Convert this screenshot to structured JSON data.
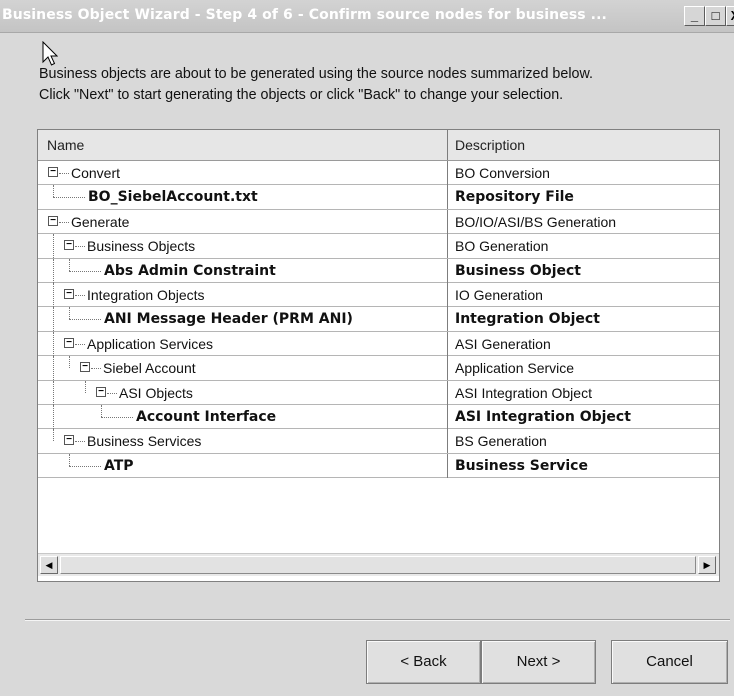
{
  "window": {
    "title": "Business Object Wizard - Step 4 of 6 - Confirm source nodes for business ...",
    "minimize_glyph": "_",
    "maximize_glyph": "□",
    "close_glyph": "X"
  },
  "instructions": {
    "line1": "Business objects are about to be generated using the source nodes summarized below.",
    "line2": "Click \"Next\" to start generating the objects or click \"Back\" to change your selection."
  },
  "table": {
    "columns": {
      "name": "Name",
      "description": "Description"
    },
    "rows": [
      {
        "name": "Convert",
        "description": "BO Conversion",
        "level": 0,
        "bold": false,
        "expander": "−"
      },
      {
        "name": "BO_SiebelAccount.txt",
        "description": "Repository File",
        "level": 1,
        "bold": true,
        "expander": ""
      },
      {
        "name": "Generate",
        "description": "BO/IO/ASI/BS Generation",
        "level": 0,
        "bold": false,
        "expander": "−"
      },
      {
        "name": "Business Objects",
        "description": "BO Generation",
        "level": 1,
        "bold": false,
        "expander": "−"
      },
      {
        "name": "Abs Admin Constraint",
        "description": "Business Object",
        "level": 2,
        "bold": true,
        "expander": ""
      },
      {
        "name": "Integration Objects",
        "description": "IO Generation",
        "level": 1,
        "bold": false,
        "expander": "−"
      },
      {
        "name": "ANI Message Header (PRM ANI)",
        "description": "Integration Object",
        "level": 2,
        "bold": true,
        "expander": ""
      },
      {
        "name": "Application Services",
        "description": "ASI Generation",
        "level": 1,
        "bold": false,
        "expander": "−"
      },
      {
        "name": "Siebel Account",
        "description": "Application Service",
        "level": 2,
        "bold": false,
        "expander": "−"
      },
      {
        "name": "ASI Objects",
        "description": "ASI Integration Object",
        "level": 3,
        "bold": false,
        "expander": "−"
      },
      {
        "name": "Account Interface",
        "description": "ASI Integration Object",
        "level": 4,
        "bold": true,
        "expander": ""
      },
      {
        "name": "Business Services",
        "description": "BS Generation",
        "level": 1,
        "bold": false,
        "expander": "−"
      },
      {
        "name": "ATP",
        "description": "Business Service",
        "level": 2,
        "bold": true,
        "expander": ""
      }
    ]
  },
  "scrollbar": {
    "left_arrow": "◀",
    "right_arrow": "▶"
  },
  "buttons": {
    "back": "< Back",
    "next": "Next >",
    "cancel": "Cancel"
  }
}
